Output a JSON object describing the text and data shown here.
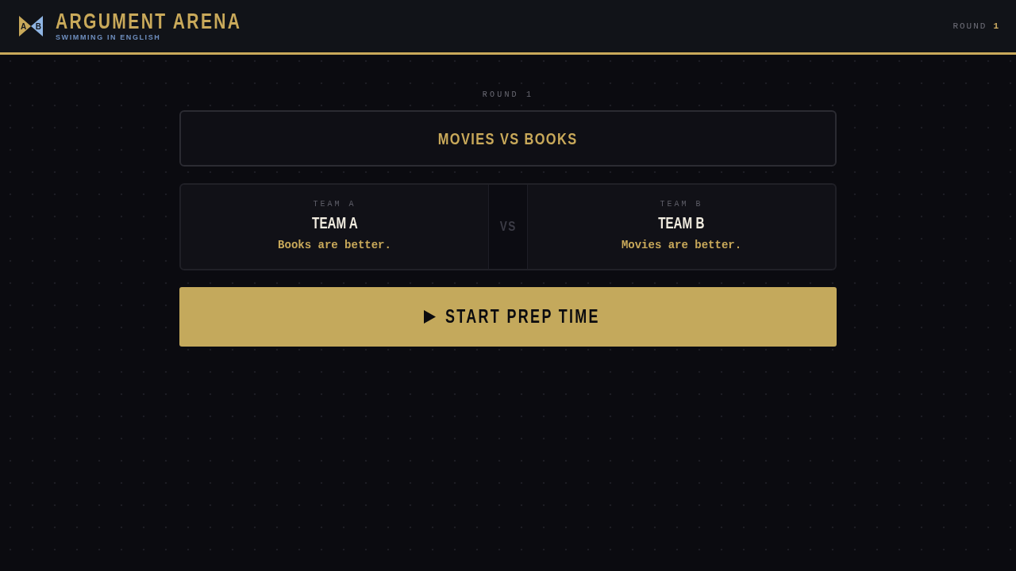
{
  "header": {
    "logo": [
      {
        "letter": "A",
        "color": "#c9a95a"
      },
      {
        "letter": "B",
        "color": "#8fb5e3"
      }
    ],
    "title": "ARGUMENT ARENA",
    "subtitle": "SWIMMING IN ENGLISH",
    "round": {
      "label": "ROUND",
      "value": "1"
    }
  },
  "round_label": "ROUND 1",
  "topic": "MOVIES VS BOOKS",
  "teams": [
    {
      "label": "TEAM A",
      "name": "TEAM A",
      "position": "Books are better."
    },
    {
      "label": "TEAM B",
      "name": "TEAM B",
      "position": "Movies are better."
    }
  ],
  "vs": "VS",
  "start_button": {
    "label": "START PREP TIME"
  }
}
